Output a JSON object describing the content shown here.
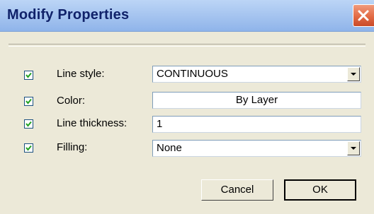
{
  "window": {
    "title": "Modify Properties"
  },
  "icons": {
    "close": "close-icon",
    "check": "checkmark-icon",
    "dropdown": "chevron-down-icon"
  },
  "rows": [
    {
      "label": "Line style:",
      "checked": true,
      "control": "dropdown",
      "value": "CONTINUOUS"
    },
    {
      "label": "Color:",
      "checked": true,
      "control": "button",
      "value": "By Layer"
    },
    {
      "label": "Line thickness:",
      "checked": true,
      "control": "text",
      "value": "1"
    },
    {
      "label": "Filling:",
      "checked": true,
      "control": "dropdown",
      "value": "None"
    }
  ],
  "buttons": {
    "cancel": "Cancel",
    "ok": "OK"
  },
  "colors": {
    "titlebar": "#a8c6f0",
    "title_text": "#10226a",
    "close": "#e26a45",
    "dialog_bg": "#ece9d8"
  }
}
